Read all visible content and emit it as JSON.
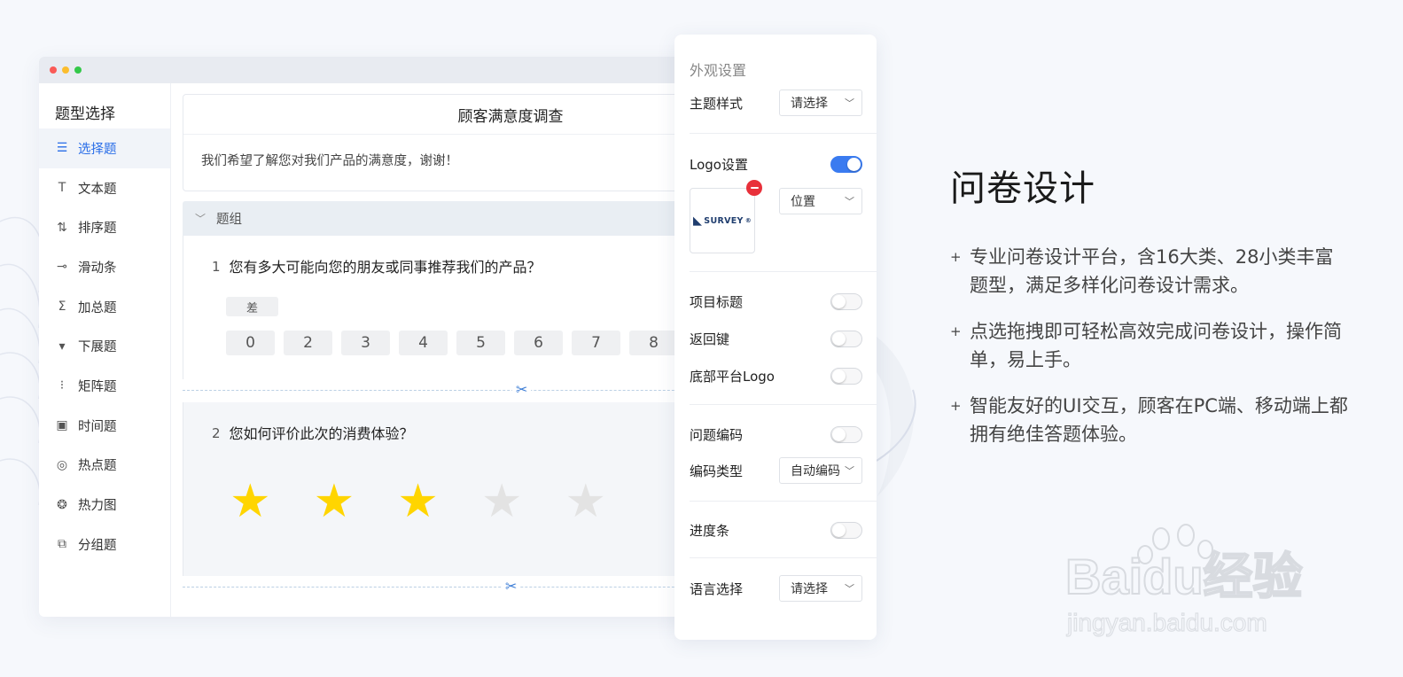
{
  "window": {
    "sidebar": {
      "title": "题型选择",
      "items": [
        {
          "label": "选择题",
          "icon": "list-icon",
          "glyph": "☰"
        },
        {
          "label": "文本题",
          "icon": "text-icon",
          "glyph": "T"
        },
        {
          "label": "排序题",
          "icon": "sort-icon",
          "glyph": "⇅"
        },
        {
          "label": "滑动条",
          "icon": "slider-icon",
          "glyph": "⊸"
        },
        {
          "label": "加总题",
          "icon": "sum-icon",
          "glyph": "Σ"
        },
        {
          "label": "下展题",
          "icon": "dropdown-icon",
          "glyph": "▾"
        },
        {
          "label": "矩阵题",
          "icon": "matrix-icon",
          "glyph": "⁝"
        },
        {
          "label": "时间题",
          "icon": "calendar-icon",
          "glyph": "▣"
        },
        {
          "label": "热点题",
          "icon": "hotspot-icon",
          "glyph": "◎"
        },
        {
          "label": "热力图",
          "icon": "heatmap-icon",
          "glyph": "❂"
        },
        {
          "label": "分组题",
          "icon": "group-icon",
          "glyph": "⧉"
        }
      ]
    },
    "survey": {
      "title": "顾客满意度调查",
      "description": "我们希望了解您对我们产品的满意度，谢谢！",
      "group_label": "题组",
      "q1": {
        "num": "1",
        "text": "您有多大可能向您的朋友或同事推荐我们的产品？",
        "low_label": "差",
        "scale": [
          "0",
          "2",
          "3",
          "4",
          "5",
          "6",
          "7",
          "8"
        ]
      },
      "q2": {
        "num": "2",
        "text": "您如何评价此次的消费体验？",
        "rating": 3,
        "max_rating": 5
      }
    }
  },
  "panel": {
    "title": "外观设置",
    "theme": {
      "label": "主题样式",
      "value": "请选择"
    },
    "logo": {
      "label": "Logo设置",
      "enabled": true,
      "position_value": "位置",
      "brand_text": "SURVEY"
    },
    "item_title": {
      "label": "项目标题",
      "enabled": false
    },
    "back_key": {
      "label": "返回键",
      "enabled": false
    },
    "footer_logo": {
      "label": "底部平台Logo",
      "enabled": false
    },
    "question_code": {
      "label": "问题编码",
      "enabled": false
    },
    "code_type": {
      "label": "编码类型",
      "value": "自动编码"
    },
    "progress": {
      "label": "进度条",
      "enabled": false
    },
    "language": {
      "label": "语言选择",
      "value": "请选择"
    }
  },
  "promo": {
    "heading": "问卷设计",
    "bullets": [
      "专业问卷设计平台，含16大类、28小类丰富题型，满足多样化问卷设计需求。",
      "点选拖拽即可轻松高效完成问卷设计，操作简单，易上手。",
      "智能友好的UI交互，顾客在PC端、移动端上都拥有绝佳答题体验。"
    ]
  },
  "watermark": {
    "brand": "Baidu经验",
    "url": "jingyan.baidu.com"
  },
  "colors": {
    "accent": "#3a7bf0",
    "star_on": "#ffd500",
    "star_off": "#e3e3e3",
    "danger": "#e8303a"
  }
}
